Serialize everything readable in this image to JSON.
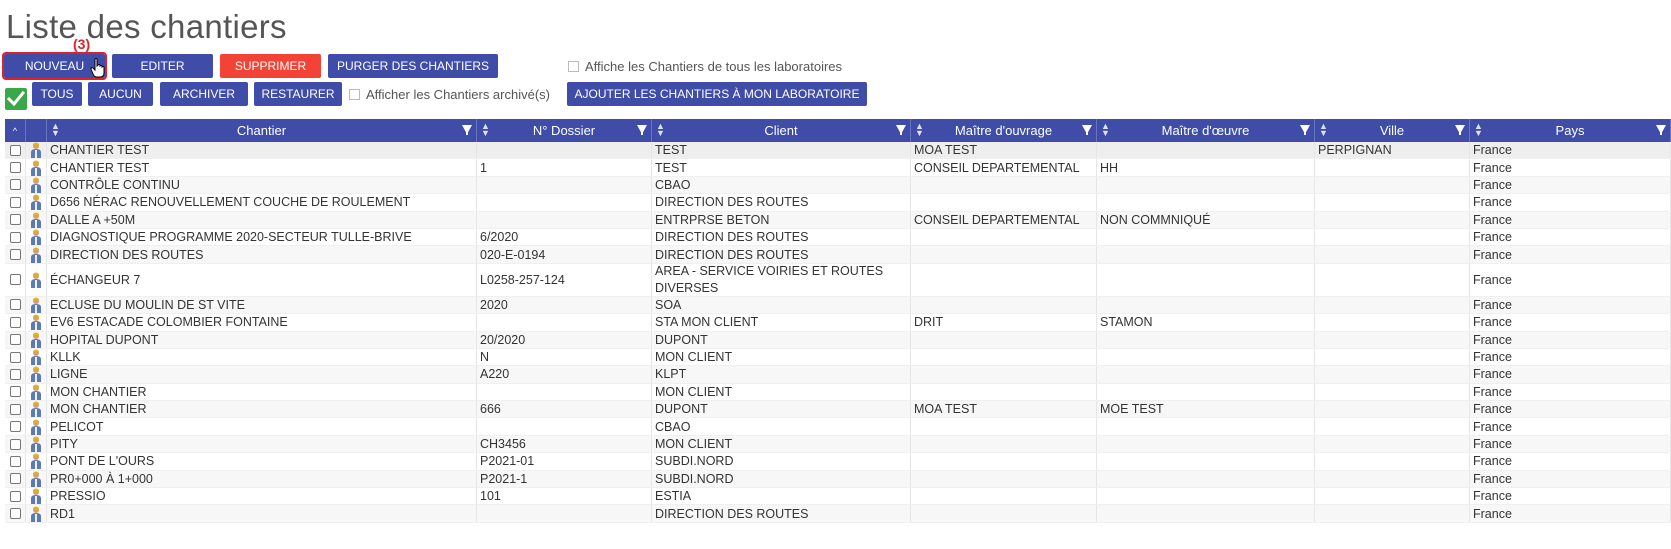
{
  "page": {
    "title": "Liste des chantiers",
    "annotation": "(3)"
  },
  "toolbar": {
    "nouveau": "NOUVEAU",
    "editer": "EDITER",
    "supprimer": "SUPPRIMER",
    "purger": "PURGER DES CHANTIERS",
    "tous_labos_label": "Affiche les Chantiers de tous les laboratoires",
    "tous": "TOUS",
    "aucun": "AUCUN",
    "archiver": "ARCHIVER",
    "restaurer": "RESTAURER",
    "archives_label": "Afficher les Chantiers archivé(s)",
    "ajouter": "AJOUTER LES CHANTIERS À MON LABORATOIRE"
  },
  "colors": {
    "primary": "#3f4ca8",
    "danger": "#f34336",
    "success": "#3aa84a",
    "highlight": "#e0202a"
  },
  "grid": {
    "columns": [
      "Chantier",
      "N° Dossier",
      "Client",
      "Maître d'ouvrage",
      "Maître d'œuvre",
      "Ville",
      "Pays"
    ],
    "rows": [
      [
        "CHANTIER TEST",
        "",
        "TEST",
        "MOA TEST",
        "",
        "PERPIGNAN",
        "France"
      ],
      [
        "CHANTIER TEST",
        "1",
        "TEST",
        "CONSEIL DEPARTEMENTAL",
        "HH",
        "",
        "France"
      ],
      [
        "CONTRÔLE CONTINU",
        "",
        "CBAO",
        "",
        "",
        "",
        "France"
      ],
      [
        "D656 NÉRAC RENOUVELLEMENT COUCHE DE ROULEMENT",
        "",
        "DIRECTION DES ROUTES",
        "",
        "",
        "",
        "France"
      ],
      [
        "DALLE A +50M",
        "",
        "ENTRPRSE BETON",
        "CONSEIL DEPARTEMENTAL",
        "NON COMMNIQUÉ",
        "",
        "France"
      ],
      [
        "DIAGNOSTIQUE PROGRAMME 2020-SECTEUR TULLE-BRIVE",
        "6/2020",
        "DIRECTION DES ROUTES",
        "",
        "",
        "",
        "France"
      ],
      [
        "DIRECTION DES ROUTES",
        "020-E-0194",
        "DIRECTION DES ROUTES",
        "",
        "",
        "",
        "France"
      ],
      [
        "ÉCHANGEUR 7",
        "L0258-257-124",
        "AREA - SERVICE VOIRIES ET ROUTES DIVERSES",
        "",
        "",
        "",
        "France"
      ],
      [
        "ECLUSE DU MOULIN DE ST VITE",
        "2020",
        "SOA",
        "",
        "",
        "",
        "France"
      ],
      [
        "EV6 ESTACADE COLOMBIER FONTAINE",
        "",
        "STA MON CLIENT",
        "DRIT",
        "STAMON",
        "",
        "France"
      ],
      [
        "HOPITAL DUPONT",
        "20/2020",
        "DUPONT",
        "",
        "",
        "",
        "France"
      ],
      [
        "KLLK",
        "N",
        "MON CLIENT",
        "",
        "",
        "",
        "France"
      ],
      [
        "LIGNE",
        "A220",
        "KLPT",
        "",
        "",
        "",
        "France"
      ],
      [
        "MON CHANTIER",
        "",
        "MON CLIENT",
        "",
        "",
        "",
        "France"
      ],
      [
        "MON CHANTIER",
        "666",
        "DUPONT",
        "MOA TEST",
        "MOE TEST",
        "",
        "France"
      ],
      [
        "PELICOT",
        "",
        "CBAO",
        "",
        "",
        "",
        "France"
      ],
      [
        "PITY",
        "CH3456",
        "MON CLIENT",
        "",
        "",
        "",
        "France"
      ],
      [
        "PONT DE L'OURS",
        "P2021-01",
        "SUBDI.NORD",
        "",
        "",
        "",
        "France"
      ],
      [
        "PR0+000 À 1+000",
        "P2021-1",
        "SUBDI.NORD",
        "",
        "",
        "",
        "France"
      ],
      [
        "PRESSIO",
        "101",
        "ESTIA",
        "",
        "",
        "",
        "France"
      ],
      [
        "RD1",
        "",
        "DIRECTION DES ROUTES",
        "",
        "",
        "",
        "France"
      ]
    ]
  }
}
